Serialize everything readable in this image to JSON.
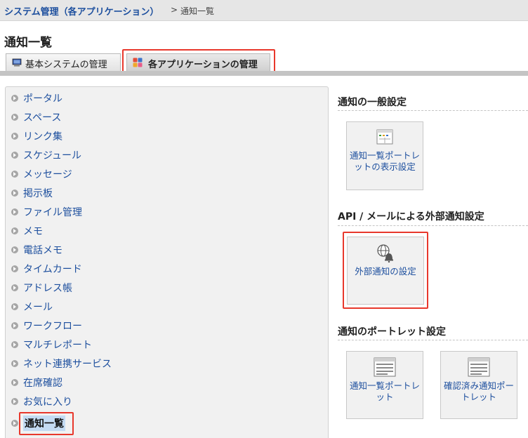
{
  "breadcrumb": {
    "parent": "システム管理（各アプリケーション）",
    "separator": ">",
    "current": "通知一覧"
  },
  "page_title": "通知一覧",
  "tabs": [
    {
      "label": "基本システムの管理",
      "icon": "monitor-icon",
      "active": false
    },
    {
      "label": "各アプリケーションの管理",
      "icon": "apps-grid-icon",
      "active": true
    }
  ],
  "sidebar": {
    "items": [
      {
        "label": "ポータル"
      },
      {
        "label": "スペース"
      },
      {
        "label": "リンク集"
      },
      {
        "label": "スケジュール"
      },
      {
        "label": "メッセージ"
      },
      {
        "label": "掲示板"
      },
      {
        "label": "ファイル管理"
      },
      {
        "label": "メモ"
      },
      {
        "label": "電話メモ"
      },
      {
        "label": "タイムカード"
      },
      {
        "label": "アドレス帳"
      },
      {
        "label": "メール"
      },
      {
        "label": "ワークフロー"
      },
      {
        "label": "マルチレポート"
      },
      {
        "label": "ネット連携サービス"
      },
      {
        "label": "在席確認"
      },
      {
        "label": "お気に入り"
      },
      {
        "label": "通知一覧",
        "active": true
      }
    ]
  },
  "sections": {
    "general": {
      "title": "通知の一般設定",
      "cards": [
        {
          "label": "通知一覧ポートレットの表示設定",
          "icon": "portlet-settings-icon"
        }
      ]
    },
    "external": {
      "title": "API / メールによる外部通知設定",
      "cards": [
        {
          "label": "外部通知の設定",
          "icon": "globe-bell-icon"
        }
      ]
    },
    "portlet": {
      "title": "通知のポートレット設定",
      "cards": [
        {
          "label": "通知一覧ポートレット",
          "icon": "portlet-list-icon"
        },
        {
          "label": "確認済み通知ポートレット",
          "icon": "portlet-list-icon"
        }
      ]
    }
  },
  "colors": {
    "link": "#1d4f9e",
    "highlight": "#e8382c",
    "active_bg": "#c4dbf3"
  }
}
